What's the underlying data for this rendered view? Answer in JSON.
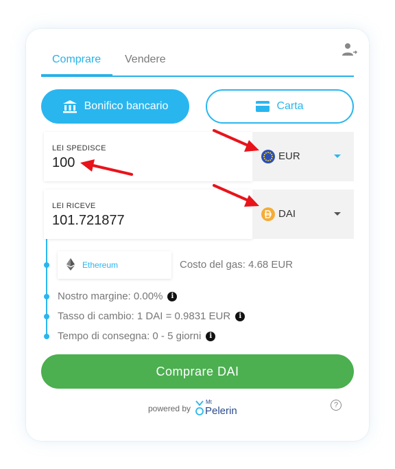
{
  "tabs": {
    "buy": "Comprare",
    "sell": "Vendere"
  },
  "payment_methods": {
    "bank": "Bonifico bancario",
    "card": "Carta"
  },
  "send": {
    "label": "LEI SPEDISCE",
    "value": "100",
    "currency": "EUR"
  },
  "receive": {
    "label": "LEI RICEVE",
    "value": "101.721877",
    "currency": "DAI"
  },
  "network": {
    "name": "Ethereum",
    "gas_cost": "Costo del gas: 4.68 EUR"
  },
  "details": {
    "margin": "Nostro margine: 0.00%",
    "rate": "Tasso di cambio: 1 DAI = 0.9831 EUR",
    "delivery": "Tempo di consegna: 0 - 5 giorni"
  },
  "buy_button": "Comprare DAI",
  "footer": {
    "powered_by": "powered by",
    "brand_prefix": "Mt",
    "brand_name": "Pelerin"
  },
  "icons": {
    "user": "user-logout-icon",
    "bank": "bank-icon",
    "card": "credit-card-icon",
    "eur": "eur-coin-icon",
    "dai": "dai-coin-icon",
    "eth": "ethereum-icon",
    "info": "info-icon",
    "help": "help-icon",
    "caret": "chevron-down-icon"
  },
  "colors": {
    "accent": "#29b6ef",
    "buy": "#4caf50",
    "eur_coin": "#2d4fb5",
    "dai_coin": "#f5ac37",
    "annotation": "#e8141b"
  }
}
